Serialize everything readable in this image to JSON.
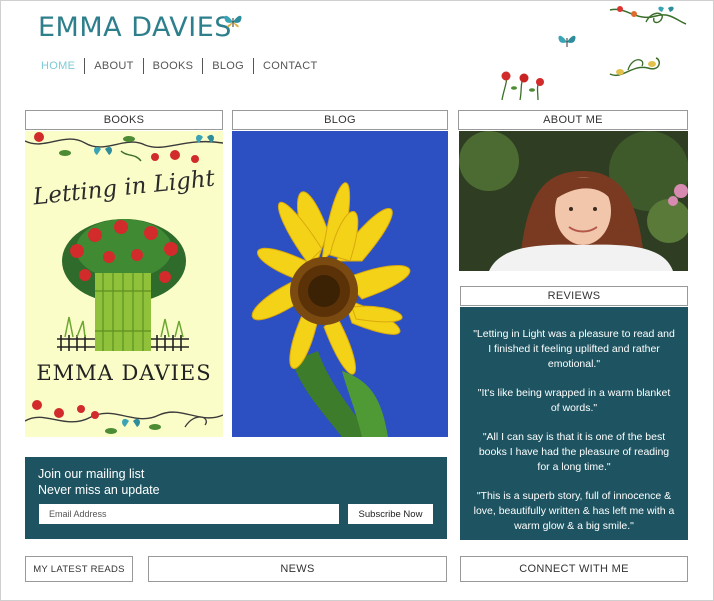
{
  "site": {
    "title": "EMMA DAVIES"
  },
  "nav": {
    "items": [
      {
        "label": "HOME",
        "active": true
      },
      {
        "label": "ABOUT"
      },
      {
        "label": "BOOKS"
      },
      {
        "label": "BLOG"
      },
      {
        "label": "CONTACT"
      }
    ]
  },
  "sections": {
    "books": {
      "header": "BOOKS",
      "cover_title": "Letting in Light",
      "cover_author": "EMMA DAVIES"
    },
    "blog": {
      "header": "BLOG"
    },
    "about": {
      "header": "ABOUT ME"
    },
    "reviews": {
      "header": "REVIEWS",
      "quotes": [
        "\"Letting in Light was a pleasure to read and I finished it feeling uplifted and rather emotional.\"",
        "\"It's like being wrapped in a warm blanket of words.\"",
        "\"All I can say is that it is one of the best books I have had the pleasure of reading for a long time.\"",
        "\"This is a superb story, full of innocence & love, beautifully written & has left me with a warm glow & a big smile.\""
      ]
    }
  },
  "mailing": {
    "line1": "Join our mailing list",
    "line2": "Never miss an update",
    "email_placeholder": "Email Address",
    "subscribe_label": "Subscribe Now"
  },
  "footer": {
    "latest_reads": "MY LATEST READS",
    "news": "NEWS",
    "connect": "CONNECT WITH ME"
  },
  "colors": {
    "brand": "#2e7f8c",
    "nav_active": "#7ccbd6",
    "panel_bg": "#1e5461",
    "cover_bg": "#fbfdc8",
    "blog_sky": "#2c4fc2"
  },
  "icons": [
    "butterfly-icon",
    "rose-icon",
    "vine-icon"
  ]
}
